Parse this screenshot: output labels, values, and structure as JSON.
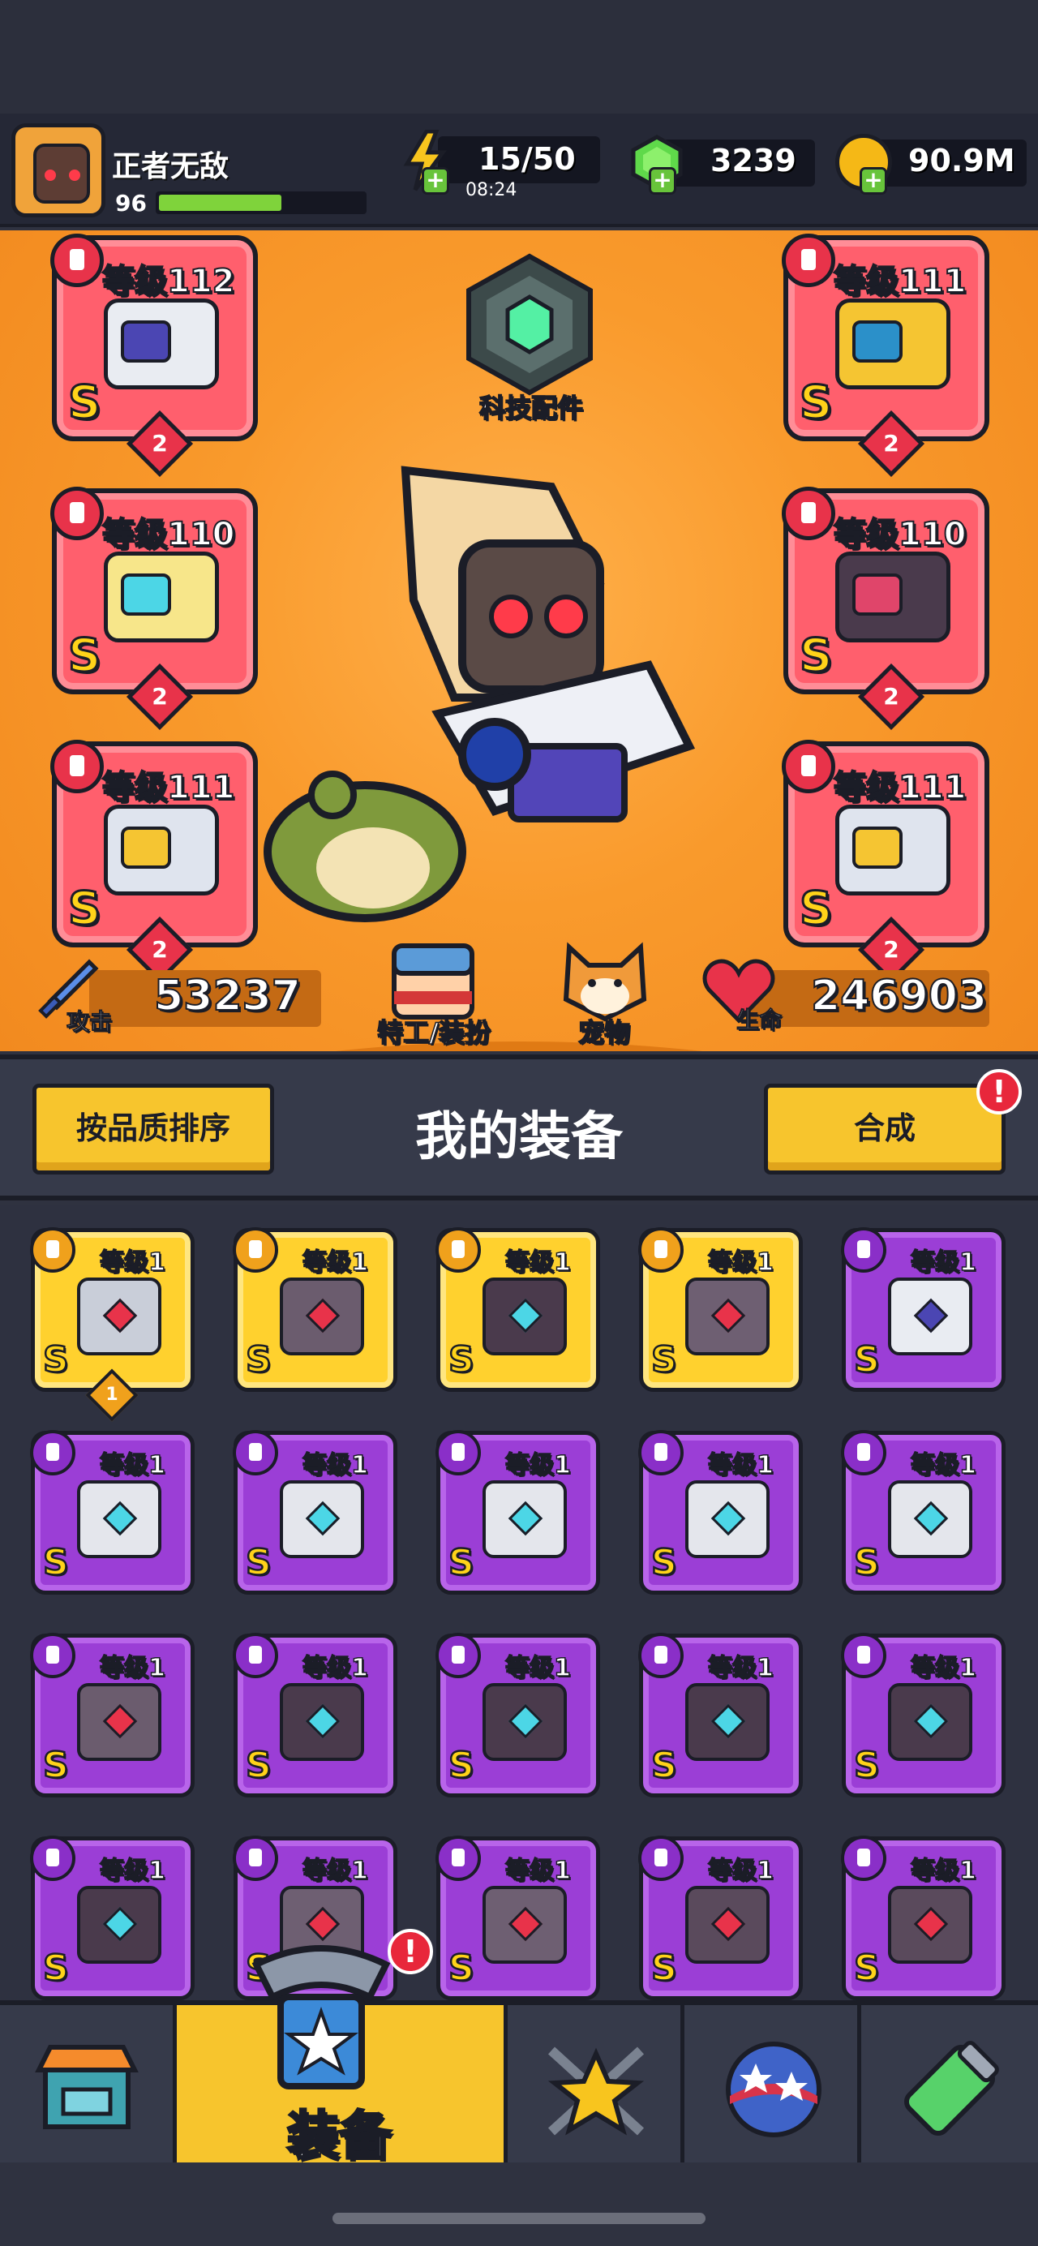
{
  "player": {
    "name": "正者无敌",
    "level": "96",
    "xp_fraction": 0.6
  },
  "resources": {
    "energy": "15/50",
    "energy_timer": "08:24",
    "gems": "3239",
    "coins": "90.9M"
  },
  "hero": {
    "tech_label": "科技配件",
    "slots": [
      {
        "level": "等级112",
        "rank": "S",
        "stars": "2",
        "icon": "weapon-icon"
      },
      {
        "level": "等级111",
        "rank": "S",
        "stars": "2",
        "icon": "armor-icon"
      },
      {
        "level": "等级110",
        "rank": "S",
        "stars": "2",
        "icon": "necklace-icon"
      },
      {
        "level": "等级110",
        "rank": "S",
        "stars": "2",
        "icon": "belt-icon"
      },
      {
        "level": "等级111",
        "rank": "S",
        "stars": "2",
        "icon": "glove-icon"
      },
      {
        "level": "等级111",
        "rank": "S",
        "stars": "2",
        "icon": "boot-icon"
      }
    ],
    "attack_label": "攻击",
    "attack_value": "53237",
    "agent_label": "特工/装扮",
    "pet_label": "宠物",
    "hp_label": "生命",
    "hp_value": "246903"
  },
  "equipment": {
    "sort_button": "按品质排序",
    "title": "我的装备",
    "merge_button": "合成",
    "alert": "!"
  },
  "inventory": [
    {
      "level": "等级1",
      "rank": "S",
      "quality": "gold",
      "icon": "sword-icon",
      "stars": "1"
    },
    {
      "level": "等级1",
      "rank": "S",
      "quality": "gold",
      "icon": "necklace-icon"
    },
    {
      "level": "等级1",
      "rank": "S",
      "quality": "gold",
      "icon": "belt-icon"
    },
    {
      "level": "等级1",
      "rank": "S",
      "quality": "gold",
      "icon": "glove-icon"
    },
    {
      "level": "等级1",
      "rank": "S",
      "quality": "purple",
      "icon": "weapon-icon"
    },
    {
      "level": "等级1",
      "rank": "S",
      "quality": "purple",
      "icon": "armor-icon"
    },
    {
      "level": "等级1",
      "rank": "S",
      "quality": "purple",
      "icon": "armor-icon"
    },
    {
      "level": "等级1",
      "rank": "S",
      "quality": "purple",
      "icon": "armor-icon"
    },
    {
      "level": "等级1",
      "rank": "S",
      "quality": "purple",
      "icon": "armor-icon"
    },
    {
      "level": "等级1",
      "rank": "S",
      "quality": "purple",
      "icon": "armor-icon"
    },
    {
      "level": "等级1",
      "rank": "S",
      "quality": "purple",
      "icon": "necklace-icon"
    },
    {
      "level": "等级1",
      "rank": "S",
      "quality": "purple",
      "icon": "belt-icon"
    },
    {
      "level": "等级1",
      "rank": "S",
      "quality": "purple",
      "icon": "belt-icon"
    },
    {
      "level": "等级1",
      "rank": "S",
      "quality": "purple",
      "icon": "belt-icon"
    },
    {
      "level": "等级1",
      "rank": "S",
      "quality": "purple",
      "icon": "belt-icon"
    },
    {
      "level": "等级1",
      "rank": "S",
      "quality": "purple",
      "icon": "belt-icon"
    },
    {
      "level": "等级1",
      "rank": "S",
      "quality": "purple",
      "icon": "glove-icon"
    },
    {
      "level": "等级1",
      "rank": "S",
      "quality": "purple",
      "icon": "glove-icon"
    },
    {
      "level": "等级1",
      "rank": "S",
      "quality": "purple",
      "icon": "boot-icon"
    },
    {
      "level": "等级1",
      "rank": "S",
      "quality": "purple",
      "icon": "boot-icon"
    }
  ],
  "nav": {
    "active_label": "装备",
    "alert": "!",
    "tabs": [
      "shop-icon",
      "equipment-icon",
      "talent-icon",
      "evolve-icon",
      "gene-icon"
    ]
  },
  "colors": {
    "hero_bg": "#f99a2c",
    "slot_red": "#ff5f6d",
    "item_gold": "#ffd12e",
    "item_purple": "#9b3ed6",
    "button_yellow": "#f7c52d",
    "xp_green": "#7fd33b"
  }
}
